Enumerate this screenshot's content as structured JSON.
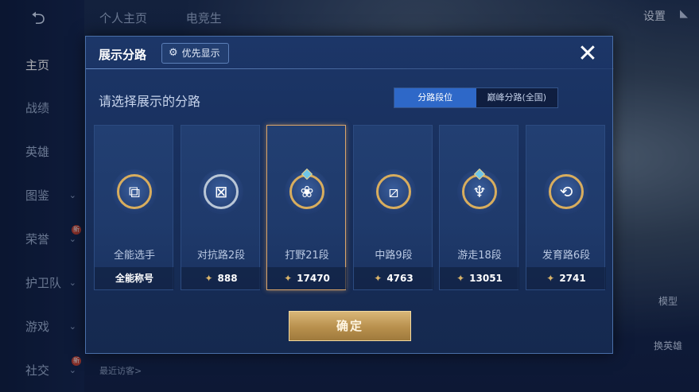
{
  "background": {
    "back_label": "⮌",
    "top_tabs": [
      "个人主页",
      "电竞生"
    ],
    "settings_label": "设置",
    "nav": [
      {
        "label": "主页",
        "chevron": false,
        "new": false
      },
      {
        "label": "战绩",
        "chevron": false,
        "new": false
      },
      {
        "label": "英雄",
        "chevron": false,
        "new": false
      },
      {
        "label": "图鉴",
        "chevron": true,
        "new": false
      },
      {
        "label": "荣誉",
        "chevron": true,
        "new": true
      },
      {
        "label": "护卫队",
        "chevron": true,
        "new": false
      },
      {
        "label": "游戏",
        "chevron": true,
        "new": false
      },
      {
        "label": "社交",
        "chevron": true,
        "new": true
      }
    ],
    "new_badge": "新",
    "visitor_label": "最近访客>",
    "right_model_label": "模型",
    "right_hero_label": "换英雄"
  },
  "modal": {
    "title": "展示分路",
    "priority_button": "优先显示",
    "close_glyph": "✕",
    "subtitle": "请选择展示的分路",
    "segments": [
      {
        "label": "分路段位",
        "selected": true
      },
      {
        "label": "巅峰分路(全国)",
        "selected": false
      }
    ],
    "cards": [
      {
        "label": "全能选手",
        "footer": "全能称号",
        "medal": false,
        "icon": "all-round-icon",
        "glyph": "⧉",
        "silver": false,
        "selected": false
      },
      {
        "label": "对抗路2段",
        "footer": "888",
        "medal": true,
        "icon": "clash-lane-icon",
        "glyph": "⊠",
        "silver": true,
        "selected": false
      },
      {
        "label": "打野21段",
        "footer": "17470",
        "medal": true,
        "icon": "jungle-icon",
        "glyph": "❀",
        "silver": false,
        "selected": true
      },
      {
        "label": "中路9段",
        "footer": "4763",
        "medal": true,
        "icon": "mid-lane-icon",
        "glyph": "⧄",
        "silver": false,
        "selected": false
      },
      {
        "label": "游走18段",
        "footer": "13051",
        "medal": true,
        "icon": "roam-icon",
        "glyph": "♆",
        "silver": false,
        "selected": false
      },
      {
        "label": "发育路6段",
        "footer": "2741",
        "medal": true,
        "icon": "farm-lane-icon",
        "glyph": "⟲",
        "silver": false,
        "selected": false
      }
    ],
    "medal_glyph": "✦",
    "confirm_label": "确定"
  },
  "colors": {
    "accent_blue": "#2e68c8",
    "gold": "#d8ad5e",
    "modal_bg": "#1c3668"
  }
}
